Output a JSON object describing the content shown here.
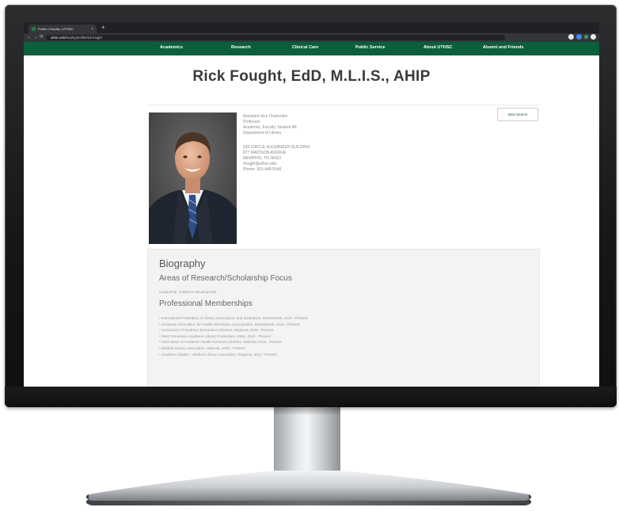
{
  "browser": {
    "tab_title": "Profile | Faculty | UTHSC",
    "tab_close": "×",
    "new_tab": "+",
    "url_domain": "uthsc.edu",
    "url_path": "/faculty/profile/rick-fought",
    "nav_glyphs": "←→⟳"
  },
  "site_nav": {
    "items": [
      {
        "label": "Academics"
      },
      {
        "label": "Research"
      },
      {
        "label": "Clinical Care"
      },
      {
        "label": "Public Service"
      },
      {
        "label": "About UTHSC"
      },
      {
        "label": "Alumni and Friends"
      }
    ]
  },
  "profile": {
    "name": "Rick Fought, EdD, M.L.I.S., AHIP",
    "new_search_label": "New Search",
    "titles": [
      "Assistant Vice Chancellor",
      "Professor",
      "Academic, Faculty, Student Aff.",
      "Department of Library"
    ],
    "contact": [
      "920 CIRCLE ALEXANDER BUILDING",
      "877 MADISON AVENUE",
      "MEMPHIS, TN 38163",
      "rfought@uthsc.edu",
      "Phone: 901-448-5646"
    ]
  },
  "biography": {
    "heading": "Biography",
    "research_heading": "Areas of Research/Scholarship Focus",
    "research_text": "Leadership, Collection Development",
    "memberships_heading": "Professional Memberships",
    "memberships": [
      "International Federation of Library Associations and Institutions, International, 2019 - Present",
      "European Association for Health Information and Libraries, International, 2019 - Present",
      "Consortium of Southern Biomedical Libraries, Regional, 2015 - Present",
      "West Tennessee Academic Library Consortium, State, 2015 - Present",
      "Association of Academic Health Sciences Libraries, National, 2015 - Present",
      "Medical Library Association, National, 2000 - Present",
      "Southern Chapter - Medical Library Association, Regional, 2011 - Present"
    ]
  },
  "colors": {
    "nav_green": "#0b5f3a",
    "title_gray": "#3a3a3a",
    "chrome_dark": "#202124"
  }
}
